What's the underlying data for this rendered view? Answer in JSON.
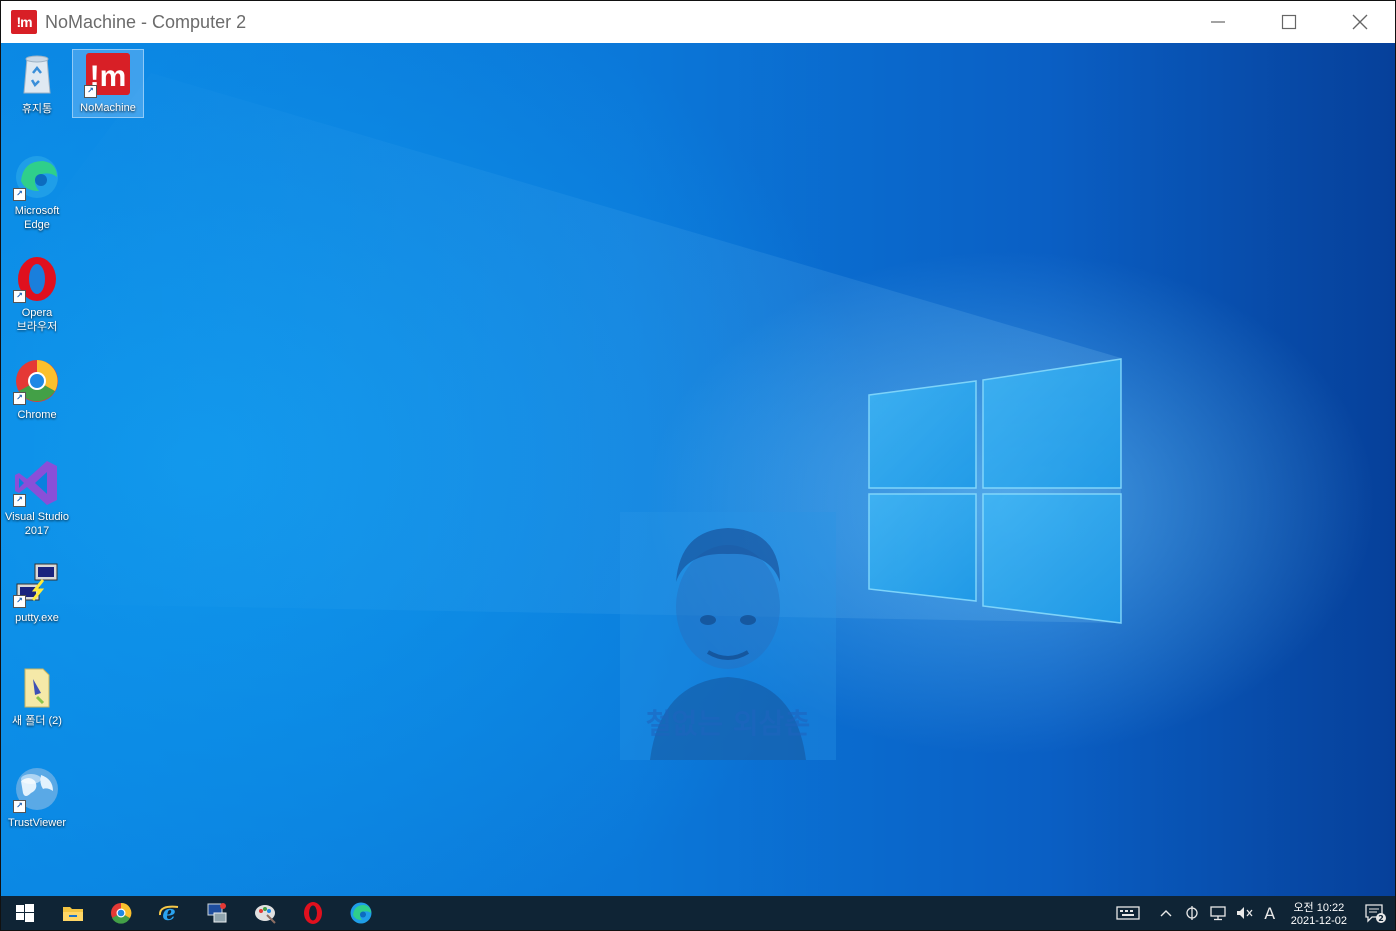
{
  "window": {
    "app_logo": "!m",
    "title": "NoMachine - Computer 2",
    "controls": [
      "minimize-icon",
      "maximize-icon",
      "close-icon"
    ]
  },
  "desktop": {
    "icons": [
      {
        "name": "recycle-bin",
        "label": "휴지통",
        "icon": "recycle-bin-icon"
      },
      {
        "name": "nomachine",
        "label": "NoMachine",
        "icon": "nomachine-icon",
        "selected": true
      },
      {
        "name": "microsoft-edge",
        "label": "Microsoft\nEdge",
        "icon": "edge-icon"
      },
      {
        "name": "opera",
        "label": "Opera\n브라우저",
        "icon": "opera-icon"
      },
      {
        "name": "chrome",
        "label": "Chrome",
        "icon": "chrome-icon"
      },
      {
        "name": "visual-studio",
        "label": "Visual Studio\n2017",
        "icon": "visual-studio-icon"
      },
      {
        "name": "putty",
        "label": "putty.exe",
        "icon": "putty-icon"
      },
      {
        "name": "new-folder",
        "label": "새 폴더 (2)",
        "icon": "folder-icon"
      },
      {
        "name": "trustviewer",
        "label": "TrustViewer",
        "icon": "globe-icon"
      }
    ],
    "watermark_text": "철없는 외삼촌"
  },
  "taskbar": {
    "pinned": [
      "windows-start-icon",
      "file-explorer-icon",
      "chrome-icon",
      "internet-explorer-icon",
      "network-app-icon",
      "paint-app-icon",
      "opera-icon",
      "edge-icon"
    ],
    "tray": {
      "ime_mode": "A",
      "clock_time": "오전 10:22",
      "clock_date": "2021-12-02",
      "notification_count": "2"
    }
  }
}
